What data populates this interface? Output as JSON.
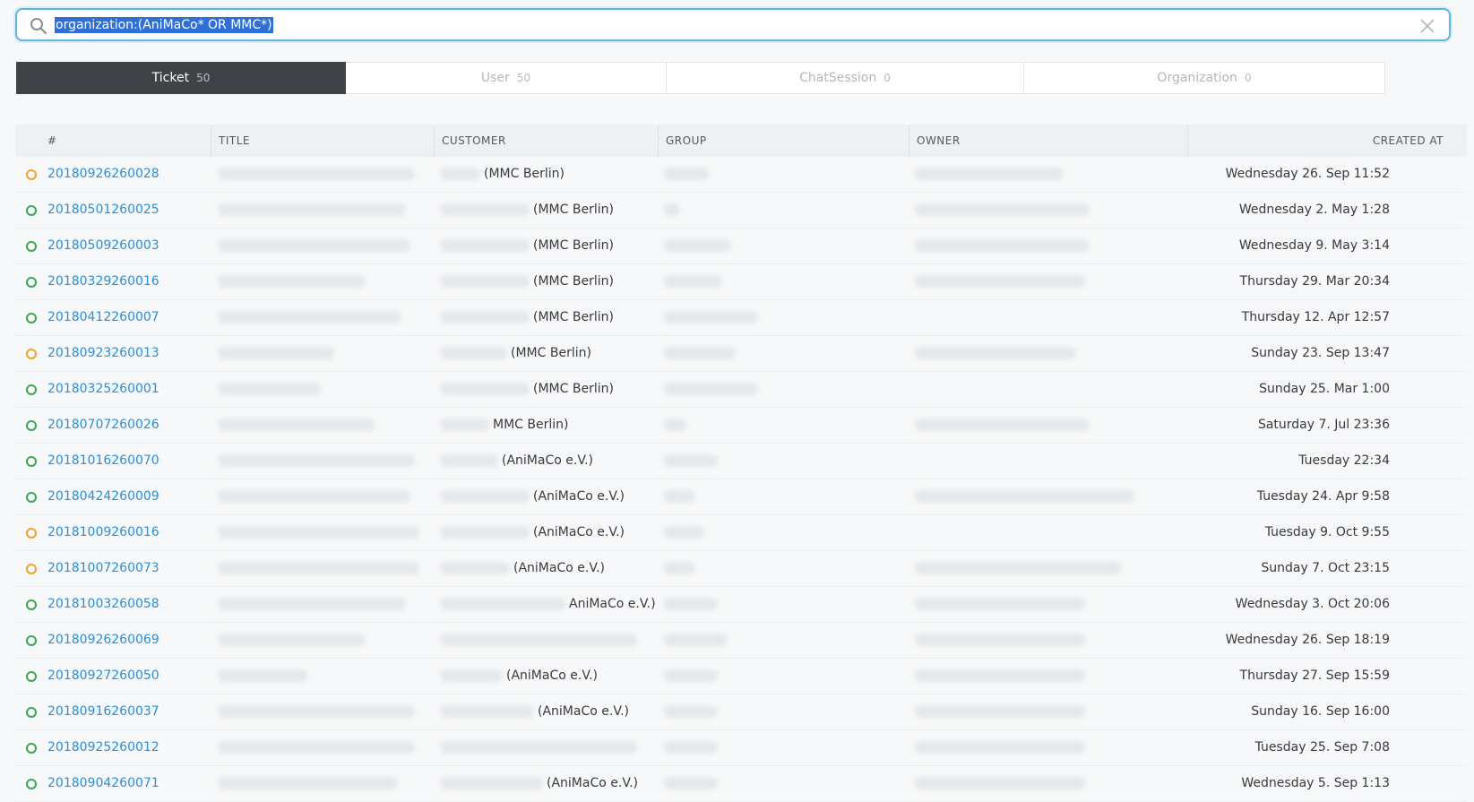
{
  "search": {
    "query": "organization:(AniMaCo* OR MMC*)"
  },
  "tabs": [
    {
      "label": "Ticket",
      "count": "50",
      "active": true
    },
    {
      "label": "User",
      "count": "50",
      "active": false
    },
    {
      "label": "ChatSession",
      "count": "0",
      "active": false
    },
    {
      "label": "Organization",
      "count": "0",
      "active": false
    }
  ],
  "columns": {
    "number": "#",
    "title": "TITLE",
    "customer": "CUSTOMER",
    "group": "GROUP",
    "owner": "OWNER",
    "created": "CREATED AT"
  },
  "colors": {
    "state_open": "#3aa65c",
    "state_pending": "#f2a12e",
    "link": "#2a8fd6",
    "search_border": "#5fb6e2",
    "tab_active": "#3f4347"
  },
  "rows": [
    {
      "number": "20180926260028",
      "state": "pending",
      "customer_org": "(MMC Berlin)",
      "created": "Wednesday 26. Sep 11:52"
    },
    {
      "number": "20180501260025",
      "state": "open",
      "customer_org": "(MMC Berlin)",
      "created": "Wednesday 2. May 1:28"
    },
    {
      "number": "20180509260003",
      "state": "open",
      "customer_org": "(MMC Berlin)",
      "created": "Wednesday 9. May 3:14"
    },
    {
      "number": "20180329260016",
      "state": "open",
      "customer_org": "(MMC Berlin)",
      "created": "Thursday 29. Mar 20:34"
    },
    {
      "number": "20180412260007",
      "state": "open",
      "customer_org": "(MMC Berlin)",
      "created": "Thursday 12. Apr 12:57"
    },
    {
      "number": "20180923260013",
      "state": "pending",
      "customer_org": "(MMC Berlin)",
      "created": "Sunday 23. Sep 13:47"
    },
    {
      "number": "20180325260001",
      "state": "open",
      "customer_org": "(MMC Berlin)",
      "created": "Sunday 25. Mar 1:00"
    },
    {
      "number": "20180707260026",
      "state": "open",
      "customer_org": "MMC Berlin)",
      "created": "Saturday 7. Jul 23:36"
    },
    {
      "number": "20181016260070",
      "state": "open",
      "customer_org": "(AniMaCo e.V.)",
      "created": "Tuesday 22:34"
    },
    {
      "number": "20180424260009",
      "state": "open",
      "customer_org": "(AniMaCo e.V.)",
      "created": "Tuesday 24. Apr 9:58"
    },
    {
      "number": "20181009260016",
      "state": "pending",
      "customer_org": "(AniMaCo e.V.)",
      "created": "Tuesday 9. Oct 9:55"
    },
    {
      "number": "20181007260073",
      "state": "pending",
      "customer_org": "(AniMaCo e.V.)",
      "created": "Sunday 7. Oct 23:15"
    },
    {
      "number": "20181003260058",
      "state": "open",
      "customer_org": "AniMaCo e.V.)",
      "created": "Wednesday 3. Oct 20:06"
    },
    {
      "number": "20180926260069",
      "state": "open",
      "customer_org": "",
      "created": "Wednesday 26. Sep 18:19"
    },
    {
      "number": "20180927260050",
      "state": "open",
      "customer_org": "(AniMaCo e.V.)",
      "created": "Thursday 27. Sep 15:59"
    },
    {
      "number": "20180916260037",
      "state": "open",
      "customer_org": "(AniMaCo e.V.)",
      "created": "Sunday 16. Sep 16:00"
    },
    {
      "number": "20180925260012",
      "state": "open",
      "customer_org": "",
      "created": "Tuesday 25. Sep 7:08"
    },
    {
      "number": "20180904260071",
      "state": "open",
      "customer_org": "(AniMaCo e.V.)",
      "created": "Wednesday 5. Sep 1:13"
    }
  ]
}
